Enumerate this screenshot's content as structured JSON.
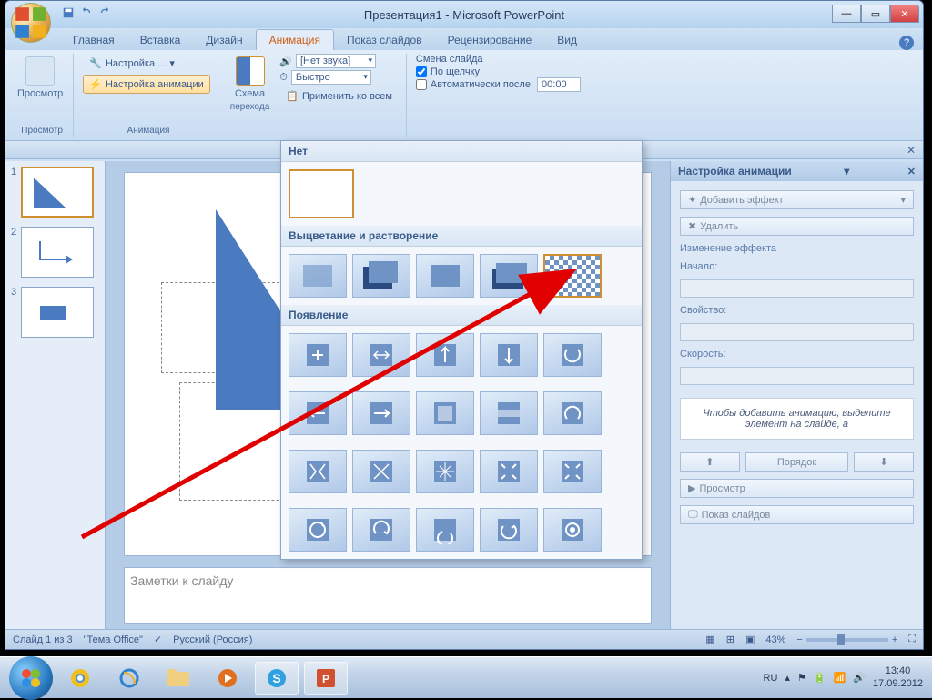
{
  "title": "Презентация1 - Microsoft PowerPoint",
  "tabs": {
    "home": "Главная",
    "insert": "Вставка",
    "design": "Дизайн",
    "animation": "Анимация",
    "slideshow": "Показ слайдов",
    "review": "Рецензирование",
    "view": "Вид"
  },
  "ribbon": {
    "preview": "Просмотр",
    "preview_group": "Просмотр",
    "custom": "Настройка ...",
    "custom_anim": "Настройка анимации",
    "anim_group": "Анимация",
    "scheme": "Схема",
    "scheme2": "перехода",
    "sound_dd": "[Нет звука]",
    "speed_dd": "Быстро",
    "apply_all": "Применить ко всем",
    "advance_head": "Смена слайда",
    "on_click": "По щелчку",
    "auto_after": "Автоматически после:",
    "auto_time": "00:00"
  },
  "gallery": {
    "none": "Нет",
    "fade": "Выцветание и растворение",
    "appear": "Появление"
  },
  "anim_pane": {
    "title": "Настройка анимации",
    "add_effect": "Добавить эффект",
    "delete": "Удалить",
    "change": "Изменение эффекта",
    "start": "Начало:",
    "property": "Свойство:",
    "speed": "Скорость:",
    "hint": "Чтобы добавить анимацию, выделите элемент на слайде, а",
    "order": "Порядок",
    "preview_btn": "Просмотр",
    "slideshow_btn": "Показ слайдов"
  },
  "notes_placeholder": "Заметки к слайду",
  "status": {
    "slide": "Слайд 1 из 3",
    "theme": "\"Тема Office\"",
    "lang": "Русский (Россия)",
    "zoom": "43%"
  },
  "slides": [
    "1",
    "2",
    "3"
  ],
  "tray": {
    "lang": "RU",
    "time": "13:40",
    "date": "17.09.2012"
  }
}
